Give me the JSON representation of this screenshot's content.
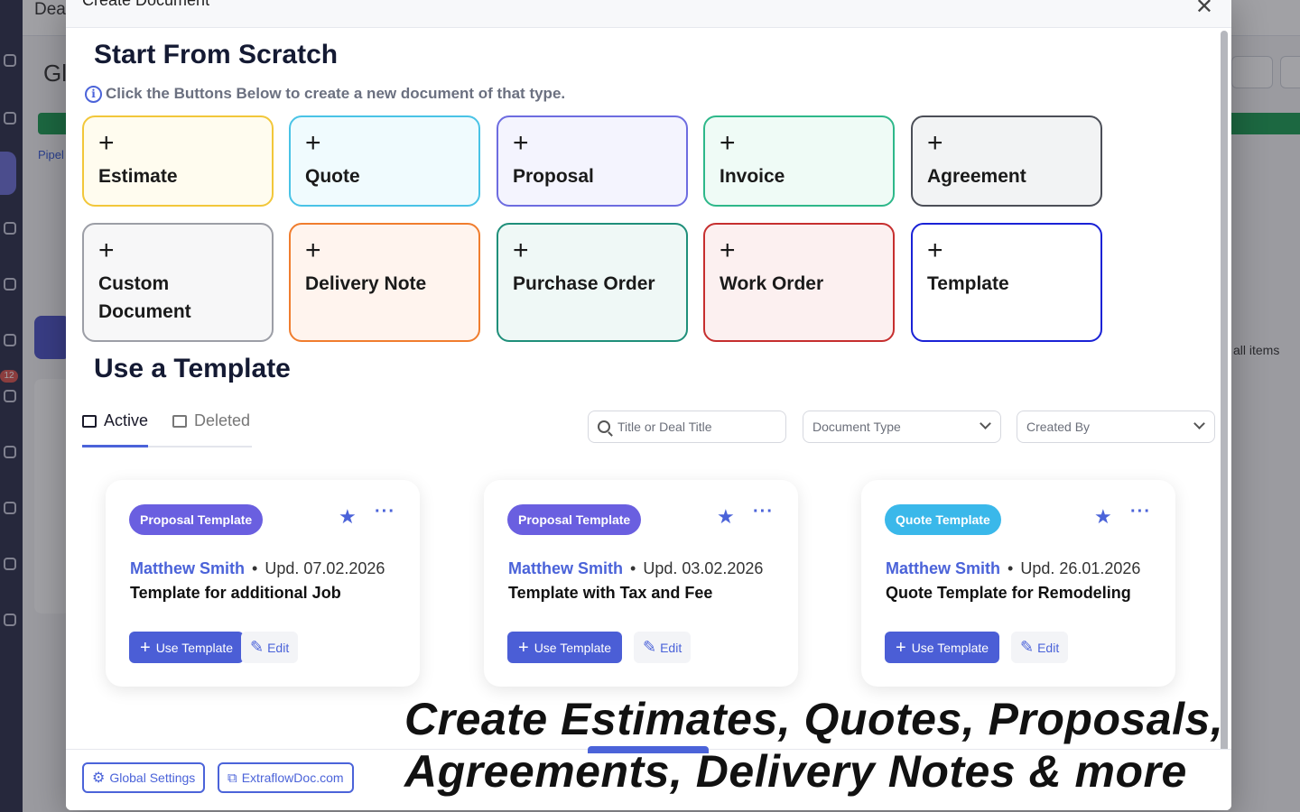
{
  "background": {
    "app_title_fragment": "Deal",
    "big_title_fragment": "Gl",
    "link_fragment": "Pipel",
    "right_text": "all items",
    "badge_count": "12"
  },
  "modal": {
    "title": "Create Document",
    "close_label": "✕"
  },
  "scratch": {
    "heading": "Start From Scratch",
    "hint": "Click the Buttons Below to create a new document of that type.",
    "tiles": [
      {
        "label": "Estimate",
        "border": "#f2c73a",
        "bg": "#fffcef"
      },
      {
        "label": "Quote",
        "border": "#49c3e6",
        "bg": "#f0fbfe"
      },
      {
        "label": "Proposal",
        "border": "#6d6ce0",
        "bg": "#f4f4fe"
      },
      {
        "label": "Invoice",
        "border": "#2eb88a",
        "bg": "#effbf6"
      },
      {
        "label": "Agreement",
        "border": "#4b4e57",
        "bg": "#f2f3f4"
      },
      {
        "label": "Custom Document",
        "border": "#9c9ea6",
        "bg": "#f7f7f8"
      },
      {
        "label": "Delivery Note",
        "border": "#f07d2e",
        "bg": "#fff4ee"
      },
      {
        "label": "Purchase Order",
        "border": "#1f8f7a",
        "bg": "#eff8f6"
      },
      {
        "label": "Work Order",
        "border": "#c62f2f",
        "bg": "#fcf0f0"
      },
      {
        "label": "Template",
        "border": "#1a22d6",
        "bg": "#ffffff"
      }
    ]
  },
  "templates": {
    "heading": "Use a Template",
    "tabs": [
      {
        "label": "Active"
      },
      {
        "label": "Deleted"
      }
    ],
    "search_placeholder": "Title or Deal Title",
    "document_type_label": "Document Type",
    "created_by_label": "Created By",
    "cards": [
      {
        "badge": "Proposal Template",
        "badge_color": "#6a5fe0",
        "author": "Matthew Smith",
        "updated": "Upd. 07.02.2026",
        "title": "Template for additional Job"
      },
      {
        "badge": "Proposal Template",
        "badge_color": "#6a5fe0",
        "author": "Matthew Smith",
        "updated": "Upd. 03.02.2026",
        "title": "Template with Tax and Fee"
      },
      {
        "badge": "Quote Template",
        "badge_color": "#3ab8ea",
        "author": "Matthew Smith",
        "updated": "Upd. 26.01.2026",
        "title": "Quote Template for Remodeling"
      }
    ],
    "use_label": "Use Template",
    "edit_label": "Edit"
  },
  "footer": {
    "global_settings": "Global Settings",
    "site_link": "ExtraflowDoc.com"
  },
  "overlay": {
    "line1": "Create Estimates, Quotes, Proposals,",
    "line2": "Agreements, Delivery Notes & more"
  }
}
